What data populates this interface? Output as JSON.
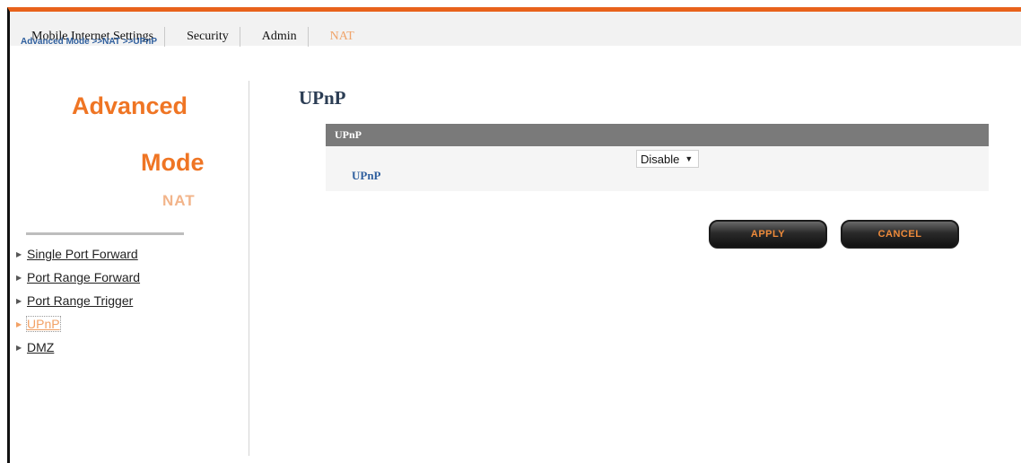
{
  "nav_tabs": [
    {
      "label": "Mobile Internet Settings"
    },
    {
      "label": "Security"
    },
    {
      "label": "Admin"
    },
    {
      "label": "NAT"
    }
  ],
  "breadcrumb": "Advanced Mode >>NAT >>UPnP",
  "sidebar": {
    "title_line1": "Advanced",
    "title_line2": "Mode",
    "subtitle": "NAT",
    "items": [
      {
        "label": "Single Port Forward"
      },
      {
        "label": "Port Range Forward"
      },
      {
        "label": "Port Range Trigger"
      },
      {
        "label": "UPnP",
        "active": true
      },
      {
        "label": "DMZ"
      }
    ]
  },
  "main": {
    "page_title": "UPnP",
    "panel_title": "UPnP",
    "field_label": "UPnP",
    "field_value": "Disable",
    "apply_label": "APPLY",
    "cancel_label": "CANCEL"
  },
  "colors": {
    "accent_orange": "#ef7524",
    "top_border": "#e8621b",
    "link_blue": "#2f5f9e",
    "panel_header": "#7a7a7a"
  }
}
